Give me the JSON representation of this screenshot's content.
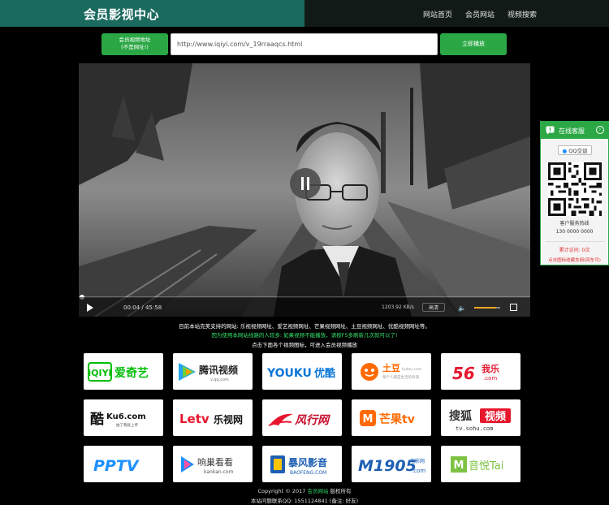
{
  "header": {
    "logo": "会员影视中心",
    "nav": [
      "网站首页",
      "会员网站",
      "视频搜索"
    ]
  },
  "url_bar": {
    "label_line1": "会员视频地址",
    "label_line2": "(不是网址!)",
    "input_value": "http://www.iqiyi.com/v_19rraaqcs.html",
    "play_button": "立即播放"
  },
  "player": {
    "time": "00:04 / 45:58",
    "speed": "1203.92 KB/s",
    "quality": "高清",
    "progress": 0.0015,
    "volume": 0.85
  },
  "notices": {
    "line1": "目前本站完美支持的网站: 乐视视频网址、爱艺视频网址、芒果视频网址、土豆视频网址、优酷视频网址等。",
    "line2": "因为使用本网站线路的人较多: 如果视频不能播放，请按F5多刷新几次就可以了!",
    "line3": "点击下面各个视频图标，可进入会员视频播放"
  },
  "sites": [
    {
      "name": "iqiyi",
      "text": "爱奇艺",
      "mark": "iQIYI"
    },
    {
      "name": "tencent",
      "text": "腾讯视频",
      "sub": "v.qq.com"
    },
    {
      "name": "youku",
      "mark": "YOUKU",
      "text": "优酷"
    },
    {
      "name": "tudou",
      "text": "土豆",
      "sub": "tudou.com",
      "tagline": "每个人都是生活的导演"
    },
    {
      "name": "56",
      "mark": "56",
      "text": "我乐",
      "sub": ".com"
    },
    {
      "name": "ku6",
      "text": "酷",
      "mark": "Ku6.com",
      "tagline": "拍了我就上传"
    },
    {
      "name": "letv",
      "mark": "Letv",
      "text": "乐视网"
    },
    {
      "name": "fengxing",
      "text": "风行网"
    },
    {
      "name": "mango",
      "text": "芒果tv"
    },
    {
      "name": "sohu",
      "text": "搜狐",
      "mark": "视频",
      "sub": "tv.sohu.com"
    },
    {
      "name": "pptv",
      "mark": "PPTV"
    },
    {
      "name": "kankan",
      "text": "响巢看看",
      "sub": "kankan.com"
    },
    {
      "name": "baofeng",
      "text": "暴风影音",
      "sub": "BAOFENG.COM"
    },
    {
      "name": "m1905",
      "mark": "M1905",
      "text": "电影网",
      "sub": ".com"
    },
    {
      "name": "yinyuetai",
      "text": "音悦Tai"
    }
  ],
  "footer": {
    "copyright_prefix": "Copyright © 2017",
    "copyright_link": "会员网站",
    "copyright_suffix": "版权所有",
    "icp": "本站问题联系QQ: 1551124841 (备注: 好友)"
  },
  "widget": {
    "title": "在线客服",
    "qq_button": "QQ交谈",
    "hotline_label": "客户服务热线",
    "hotline": "130 0000 0000",
    "counter": "累计访问: 0次",
    "link": "点击图标收藏本网(回车可)"
  },
  "colors": {
    "accent": "#2ba845",
    "header": "#1b6a5e",
    "notice_green": "#35e06b",
    "link_red": "#e03030"
  }
}
